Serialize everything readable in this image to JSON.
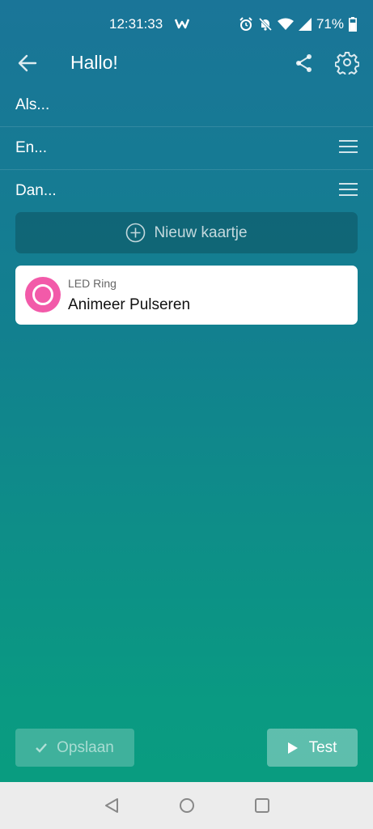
{
  "status_bar": {
    "time": "12:31:33",
    "battery": "71%",
    "icons": [
      "app-logo-icon",
      "alarm-icon",
      "mute-icon",
      "wifi-icon",
      "signal-icon",
      "battery-icon"
    ]
  },
  "app_bar": {
    "title": "Hallo!",
    "icons": [
      "back-arrow-icon",
      "share-icon",
      "gear-icon"
    ]
  },
  "sections": {
    "if_label": "Als...",
    "and_label": "En...",
    "then_label": "Dan..."
  },
  "new_card": {
    "label": "Nieuw kaartje",
    "icon": "plus-circle-icon"
  },
  "cards": [
    {
      "device": "LED Ring",
      "action": "Animeer Pulseren",
      "icon": "led-ring-icon",
      "icon_color": "#f25aa9"
    }
  ],
  "buttons": {
    "save_label": "Opslaan",
    "test_label": "Test"
  },
  "nav": {
    "icons": [
      "nav-back-icon",
      "nav-home-icon",
      "nav-recents-icon"
    ]
  },
  "colors": {
    "background_top": "#1a7598",
    "background_bottom": "#099c80",
    "accent_pink": "#f25aa9"
  }
}
